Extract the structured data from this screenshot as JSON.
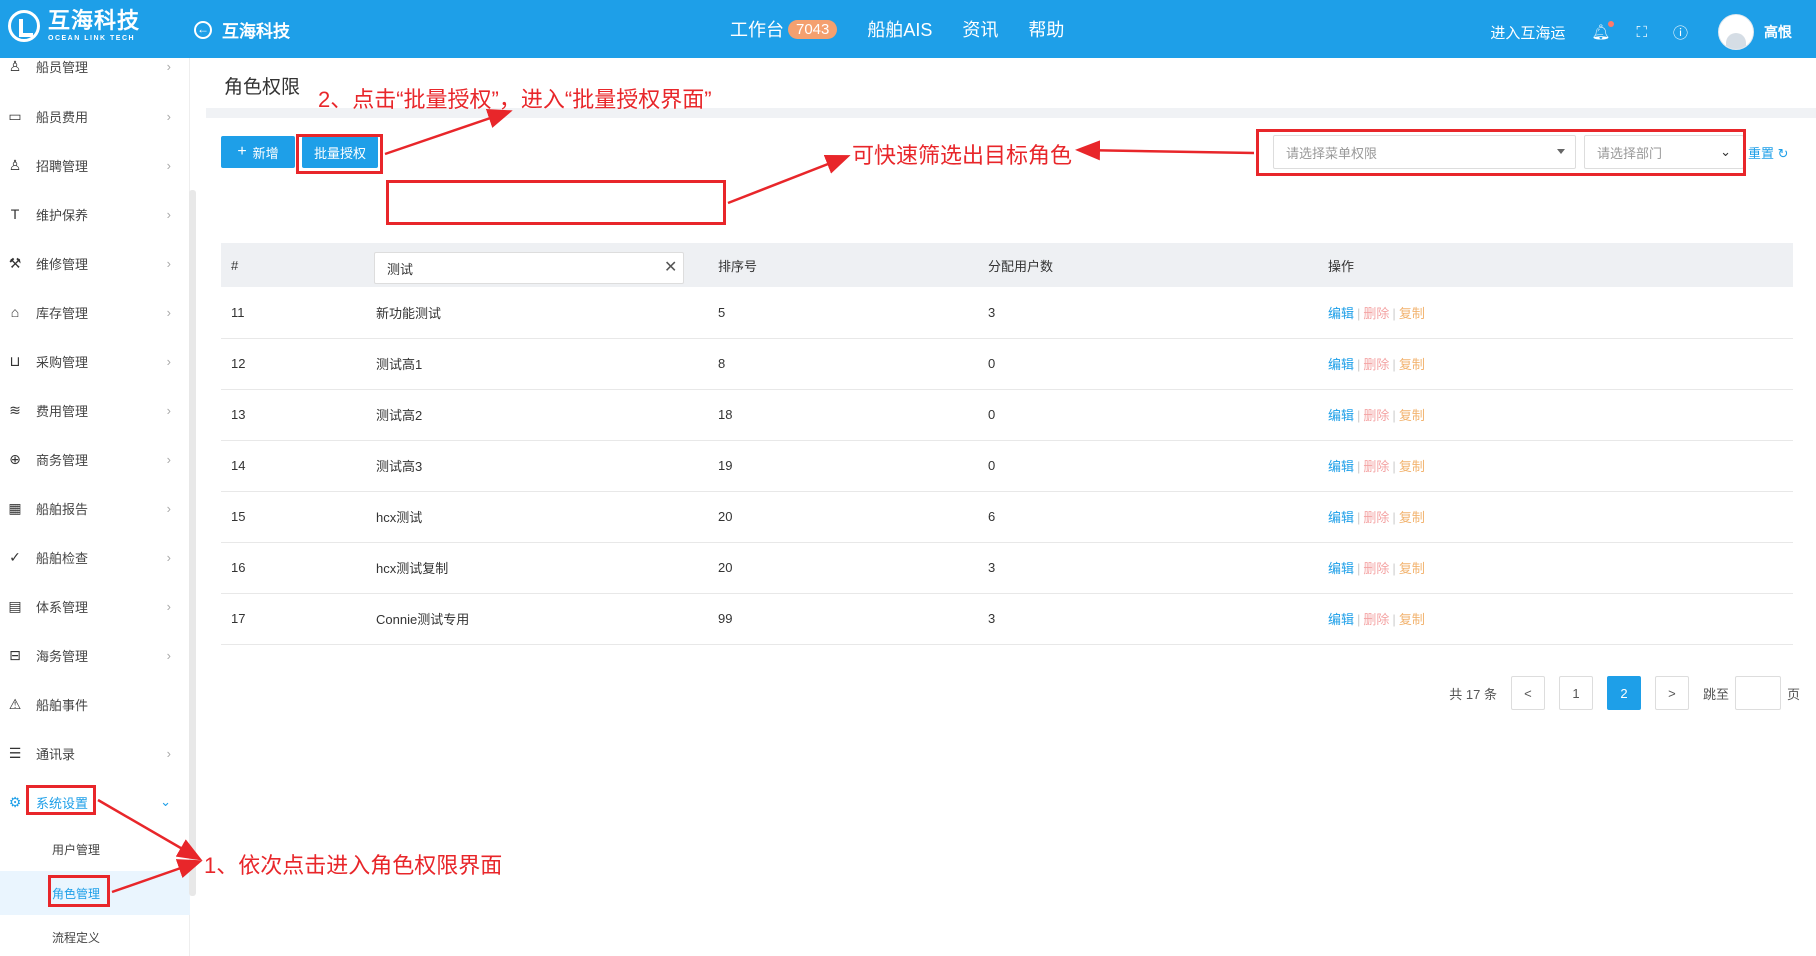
{
  "topbar": {
    "logo_cn": "互海科技",
    "logo_en": "OCEAN LINK TECH",
    "back_label": "互海科技",
    "nav": [
      {
        "label": "工作台",
        "badge": "7043"
      },
      {
        "label": "船舶AIS"
      },
      {
        "label": "资讯"
      },
      {
        "label": "帮助"
      }
    ],
    "enter_link": "进入互海运",
    "user_name": "高恨"
  },
  "sidebar": {
    "items": [
      {
        "label": "船员管理",
        "icon": "user-icon"
      },
      {
        "label": "船员费用",
        "icon": "wallet-icon"
      },
      {
        "label": "招聘管理",
        "icon": "recruit-icon"
      },
      {
        "label": "维护保养",
        "icon": "tool-icon"
      },
      {
        "label": "维修管理",
        "icon": "wrench-icon"
      },
      {
        "label": "库存管理",
        "icon": "warehouse-icon"
      },
      {
        "label": "采购管理",
        "icon": "cart-icon"
      },
      {
        "label": "费用管理",
        "icon": "database-icon"
      },
      {
        "label": "商务管理",
        "icon": "globe-icon"
      },
      {
        "label": "船舶报告",
        "icon": "calendar-icon"
      },
      {
        "label": "船舶检查",
        "icon": "check-circle-icon"
      },
      {
        "label": "体系管理",
        "icon": "docs-icon"
      },
      {
        "label": "海务管理",
        "icon": "signpost-icon"
      },
      {
        "label": "船舶事件",
        "icon": "warning-icon"
      },
      {
        "label": "通讯录",
        "icon": "server-icon"
      },
      {
        "label": "系统设置",
        "icon": "gear-icon"
      }
    ],
    "sub_items": [
      {
        "label": "用户管理"
      },
      {
        "label": "角色管理"
      },
      {
        "label": "流程定义"
      }
    ]
  },
  "page": {
    "title": "角色权限",
    "add_button": "新增",
    "batch_button": "批量授权",
    "menu_select_placeholder": "请选择菜单权限",
    "dept_select_placeholder": "请选择部门",
    "reset_label": "重置",
    "name_filter_value": "测试"
  },
  "table": {
    "headers": [
      "#",
      "",
      "排序号",
      "分配用户数",
      "操作"
    ],
    "op_labels": {
      "edit": "编辑",
      "delete": "删除",
      "copy": "复制"
    },
    "rows": [
      {
        "id": "11",
        "name": "新功能测试",
        "sort": "5",
        "users": "3"
      },
      {
        "id": "12",
        "name": "测试高1",
        "sort": "8",
        "users": "0"
      },
      {
        "id": "13",
        "name": "测试高2",
        "sort": "18",
        "users": "0"
      },
      {
        "id": "14",
        "name": "测试高3",
        "sort": "19",
        "users": "0"
      },
      {
        "id": "15",
        "name": "hcx测试",
        "sort": "20",
        "users": "6"
      },
      {
        "id": "16",
        "name": "hcx测试复制",
        "sort": "20",
        "users": "3"
      },
      {
        "id": "17",
        "name": "Connie测试专用",
        "sort": "99",
        "users": "3"
      }
    ]
  },
  "pager": {
    "total_text": "共 17 条",
    "prev": "<",
    "pages": [
      "1",
      "2"
    ],
    "current": "2",
    "next": ">",
    "goto_label": "跳至",
    "page_unit": "页"
  },
  "annotations": {
    "step1": "1、依次点击进入角色权限界面",
    "step2": "2、点击“批量授权”，进入“批量授权界面”",
    "filter_note": "可快速筛选出目标角色"
  },
  "colors": {
    "primary": "#1e9fe8",
    "annotation": "#e8262a",
    "badge": "#f4a06f"
  }
}
